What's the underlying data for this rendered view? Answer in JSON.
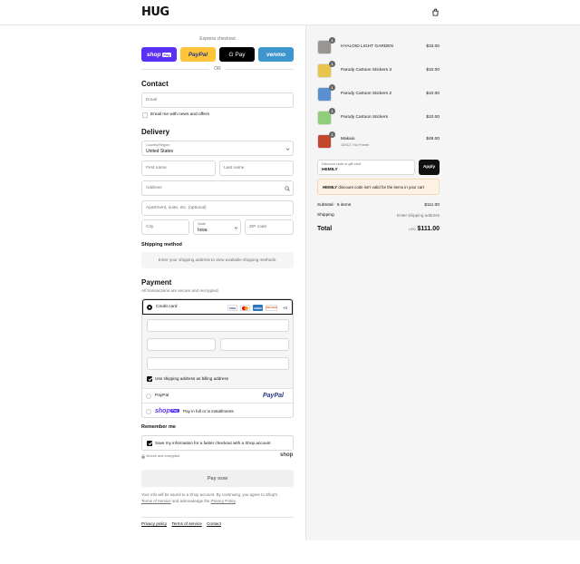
{
  "header": {
    "logo": "HUG",
    "bag_icon": "shopping-bag-icon"
  },
  "express": {
    "title": "Express checkout",
    "buttons": [
      {
        "label": "shop",
        "badge": "Pay",
        "color": "#5a31f4"
      },
      {
        "label": "PayPal",
        "color": "#ffc439"
      },
      {
        "label": "G Pay",
        "color": "#000000"
      },
      {
        "label": "venmo",
        "color": "#3d95ce"
      }
    ],
    "or": "OR"
  },
  "contact": {
    "heading": "Contact",
    "email_placeholder": "Email",
    "newsletter_label": "Email me with news and offers"
  },
  "delivery": {
    "heading": "Delivery",
    "country_label": "Country/Region",
    "country_value": "United States",
    "first_name": "First name",
    "last_name": "Last name",
    "address": "Address",
    "apartment": "Apartment, suite, etc. (optional)",
    "city": "City",
    "state_label": "State",
    "state_value": "Iowa",
    "zip": "ZIP code"
  },
  "shipping_method": {
    "heading": "Shipping method",
    "message": "Enter your shipping address to view available shipping methods."
  },
  "payment": {
    "heading": "Payment",
    "subtitle": "All transactions are secure and encrypted.",
    "credit_card_label": "Credit card",
    "more_cards": "+4",
    "card_brands": [
      "VISA",
      "MC",
      "AMEX",
      "DISCOVER"
    ],
    "billing_label": "Use shipping address as billing address",
    "paypal_label": "PayPal",
    "paypal_logo": "PayPal",
    "shoppay_logo": "shop",
    "shoppay_badge": "Pay",
    "shoppay_label": "Pay in full or in installments"
  },
  "remember": {
    "heading": "Remember me",
    "label": "Save my information for a faster checkout with a Shop account",
    "secure": "Secure and encrypted",
    "shop": "shop"
  },
  "pay_button": "Pay now",
  "legal": {
    "line1": "Your info will be saved to a Shop account. By continuing, you agree to Shop's",
    "tos": "Terms of Service",
    "and": "and acknowledge the",
    "privacy": "Privacy Policy",
    "end": "."
  },
  "footer_links": [
    "Privacy policy",
    "Terms of service",
    "Contact"
  ],
  "order": {
    "items": [
      {
        "name": "HYALOID LIGHT GARDEN",
        "variant": "",
        "qty": "1",
        "price": "$33.00",
        "thumb_color": "#9a9590"
      },
      {
        "name": "Parody Cartoon Stickers 3",
        "variant": "",
        "qty": "1",
        "price": "$10.00",
        "thumb_color": "#e8c44a"
      },
      {
        "name": "Parody Cartoon Stickers 2",
        "variant": "",
        "qty": "1",
        "price": "$10.00",
        "thumb_color": "#5a8fd1"
      },
      {
        "name": "Parody Cartoon Stickers",
        "variant": "",
        "qty": "1",
        "price": "$10.00",
        "thumb_color": "#8fcf7a"
      },
      {
        "name": "Makaio",
        "variant": "10X12 / No Frame",
        "qty": "1",
        "price": "$48.00",
        "thumb_color": "#c2472c"
      }
    ],
    "discount_label": "Discount code or gift card",
    "discount_value": "HEMILY",
    "apply": "Apply",
    "error_code": "HEMILY",
    "error_text": "discount code isn't valid for the items in your cart",
    "subtotal_label": "Subtotal · 5 items",
    "subtotal_value": "$111.00",
    "shipping_label": "Shipping",
    "shipping_value": "Enter shipping address",
    "total_label": "Total",
    "currency": "USD",
    "total_value": "$111.00"
  }
}
